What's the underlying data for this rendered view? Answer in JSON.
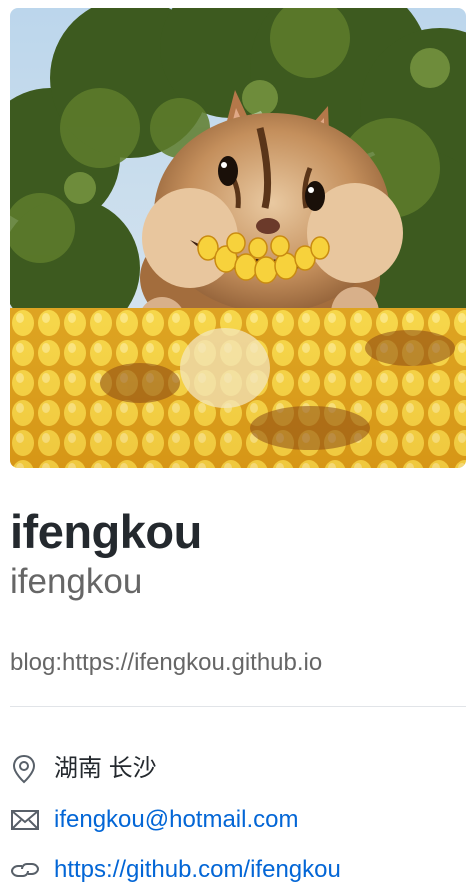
{
  "profile": {
    "avatar": {
      "alt": "chipmunk eating corn",
      "icon": "avatar-image"
    },
    "fullname": "ifengkou",
    "username": "ifengkou",
    "bio": "blog:https://ifengkou.github.io"
  },
  "details": {
    "location": {
      "icon": "location-pin-icon",
      "text": "湖南 长沙"
    },
    "email": {
      "icon": "mail-icon",
      "text": "ifengkou@hotmail.com"
    },
    "url": {
      "icon": "link-icon",
      "text": "https://github.com/ifengkou"
    }
  },
  "colors": {
    "link": "#0366d6",
    "primary_text": "#24292e",
    "secondary_text": "#666666",
    "divider": "#e1e4e8"
  }
}
